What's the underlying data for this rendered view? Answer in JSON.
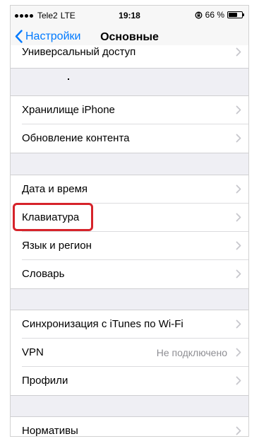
{
  "status_bar": {
    "carrier": "Tele2",
    "network": "LTE",
    "time": "19:18",
    "battery_percent": "66 %",
    "battery_level": 0.66
  },
  "nav": {
    "back_label": "Настройки",
    "title": "Основные"
  },
  "rows": {
    "universal_access": "Универсальный доступ",
    "iphone_storage": "Хранилище iPhone",
    "content_update": "Обновление контента",
    "date_time": "Дата и время",
    "keyboard": "Клавиатура",
    "language_region": "Язык и регион",
    "dictionary": "Словарь",
    "itunes_sync": "Синхронизация с iTunes по Wi-Fi",
    "vpn": "VPN",
    "vpn_status": "Не подключено",
    "profiles": "Профили",
    "regulatory": "Нормативы"
  },
  "colors": {
    "accent": "#007aff",
    "highlight": "#d6232a",
    "background": "#efeff4"
  }
}
